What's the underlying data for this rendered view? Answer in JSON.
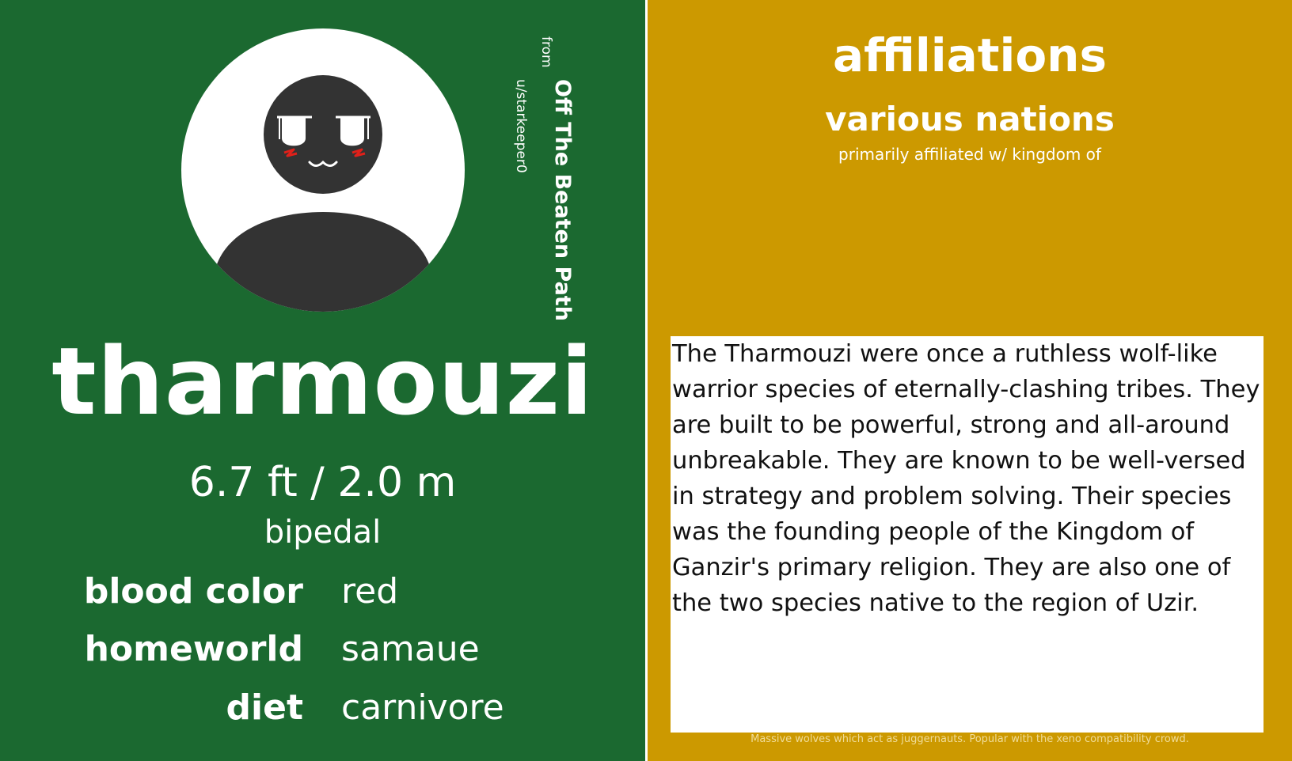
{
  "card": {
    "species_name": "tharmouzi",
    "height": "6.7 ft / 2.0 m",
    "posture": "bipedal",
    "stats": [
      {
        "label": "blood color",
        "value": "red"
      },
      {
        "label": "homeworld",
        "value": "samaue"
      },
      {
        "label": "diet",
        "value": "carnivore"
      }
    ]
  },
  "credit": {
    "from_label": "from",
    "source_title": "Off The Beaten Path",
    "author": "u/starkeeper0"
  },
  "affiliations": {
    "heading": "affiliations",
    "name": "various nations",
    "note": "primarily affiliated w/ kingdom of"
  },
  "description": "The Tharmouzi were once a ruthless wolf-like warrior species of eternally-clashing tribes. They are built to be powerful, strong and all-around unbreakable. They are known to be well-versed in strategy and problem solving. Their species was the founding people of the Kingdom of Ganzir's primary religion. They are also one of the two species native to the region of Uzir.",
  "footer_caption": "Massive wolves which act as juggernauts. Popular with the xeno compatibility crowd.",
  "colors": {
    "left_panel": "#1b6930",
    "right_panel": "#cc9900",
    "avatar_figure": "#333333",
    "blush": "#e0201a"
  },
  "icons": {
    "avatar": "default-person-avatar"
  }
}
